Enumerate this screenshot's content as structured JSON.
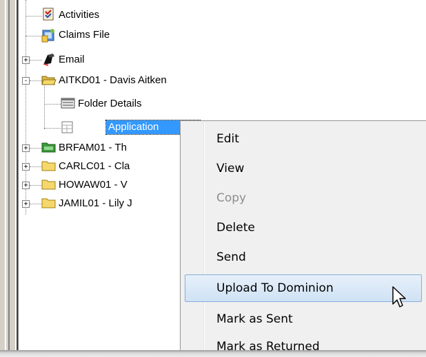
{
  "tree": {
    "items": [
      {
        "label": "Activities",
        "icon": "activities-icon"
      },
      {
        "label": "Claims File",
        "icon": "claims-file-icon"
      },
      {
        "label": "Email",
        "icon": "email-icon",
        "expander": "+"
      },
      {
        "label": "AITKD01 - Davis Aitken",
        "icon": "open-folder-icon",
        "expander": "-"
      },
      {
        "label": "Folder Details",
        "icon": "folder-details-icon"
      },
      {
        "label": "Application",
        "icon": "application-form-icon",
        "selected": true
      },
      {
        "label": "BRFAM01 - Th",
        "icon": "folder-icon",
        "expander": "+"
      },
      {
        "label": "CARLC01 - Cla",
        "icon": "folder-icon",
        "expander": "+"
      },
      {
        "label": "HOWAW01 - V",
        "icon": "folder-icon",
        "expander": "+"
      },
      {
        "label": "JAMIL01 - Lily J",
        "icon": "folder-icon",
        "expander": "+"
      }
    ]
  },
  "context_menu": {
    "items": [
      {
        "label": "Edit",
        "enabled": true
      },
      {
        "label": "View",
        "enabled": true
      },
      {
        "label": "Copy",
        "enabled": false
      },
      {
        "label": "Delete",
        "enabled": true
      },
      {
        "label": "Send",
        "enabled": true
      },
      {
        "label": "Upload To Dominion",
        "enabled": true,
        "highlighted": true
      },
      {
        "label": "Mark as  Sent",
        "enabled": true
      },
      {
        "label": "Mark as Returned",
        "enabled": true
      }
    ]
  },
  "colors": {
    "selection": "#3399ff",
    "menu_background": "#f0f0f0",
    "menu_highlight_border": "#84acdd",
    "folder_yellow": "#f5d76e"
  }
}
